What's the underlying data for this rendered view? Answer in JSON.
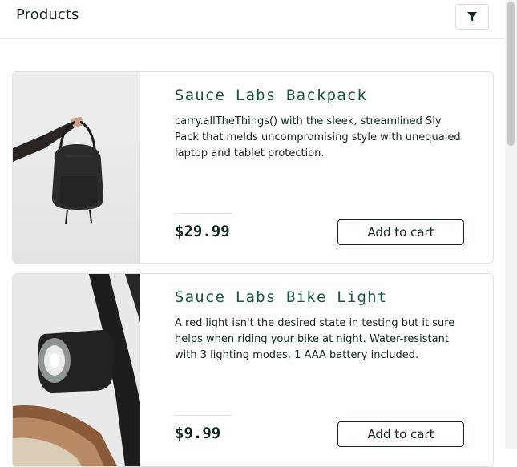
{
  "header": {
    "title": "Products",
    "filter_icon": "filter-icon"
  },
  "products": [
    {
      "name": "Sauce Labs Backpack",
      "description": "carry.allTheThings() with the sleek, streamlined Sly Pack that melds uncompromising style with unequaled laptop and tablet protection.",
      "price": "$29.99",
      "button_label": "Add to cart"
    },
    {
      "name": "Sauce Labs Bike Light",
      "description": "A red light isn't the desired state in testing but it sure helps when riding your bike at night. Water-resistant with 3 lighting modes, 1 AAA battery included.",
      "price": "$9.99",
      "button_label": "Add to cart"
    }
  ],
  "colors": {
    "product_name": "#18583a",
    "text": "#132322"
  }
}
